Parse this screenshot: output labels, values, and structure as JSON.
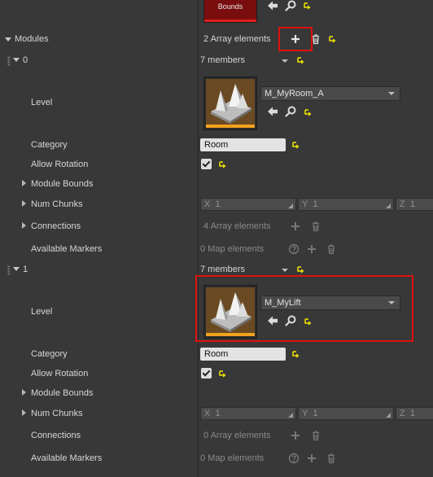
{
  "top": {
    "thumb_label": "Bounds"
  },
  "modules": {
    "label": "Modules",
    "count_text": "2 Array elements",
    "items": [
      {
        "index": "0",
        "members": "7 members",
        "level_label": "Level",
        "level_asset": "M_MyRoom_A",
        "category_label": "Category",
        "category_value": "Room",
        "allow_rotation_label": "Allow Rotation",
        "allow_rotation_checked": true,
        "module_bounds_label": "Module Bounds",
        "num_chunks_label": "Num Chunks",
        "num_chunks": {
          "x_label": "X",
          "x_value": "1",
          "y_label": "Y",
          "y_value": "1",
          "z_label": "Z",
          "z_value": "1"
        },
        "connections_label": "Connections",
        "connections_value": "4 Array elements",
        "available_markers_label": "Available Markers",
        "available_markers_value": "0 Map elements"
      },
      {
        "index": "1",
        "members": "7 members",
        "level_label": "Level",
        "level_asset": "M_MyLift",
        "category_label": "Category",
        "category_value": "Room",
        "allow_rotation_label": "Allow Rotation",
        "allow_rotation_checked": true,
        "module_bounds_label": "Module Bounds",
        "num_chunks_label": "Num Chunks",
        "num_chunks": {
          "x_label": "X",
          "x_value": "1",
          "y_label": "Y",
          "y_value": "1",
          "z_label": "Z",
          "z_value": "1"
        },
        "connections_label": "Connections",
        "connections_value": "0 Array elements",
        "available_markers_label": "Available Markers",
        "available_markers_value": "0 Map elements"
      }
    ]
  },
  "colors": {
    "highlight": "#e01010",
    "asset_bar": "#f0a21e",
    "reset_arrow": "#f2e600"
  }
}
